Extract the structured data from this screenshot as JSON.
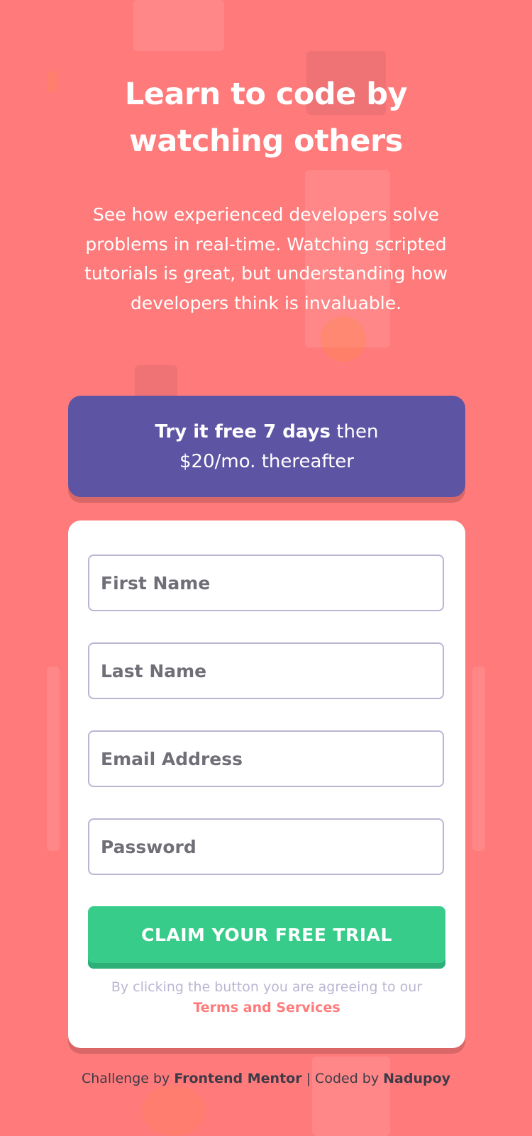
{
  "hero": {
    "title": "Learn to code by watching others",
    "description": "See how experienced developers solve problems in real-time. Watching scripted tutorials is great, but understanding how developers think is invaluable."
  },
  "promo": {
    "bold": "Try it free 7 days",
    "rest_1": " then",
    "rest_2": "$20/mo. thereafter"
  },
  "form": {
    "first_name_placeholder": "First Name",
    "last_name_placeholder": "Last Name",
    "email_placeholder": "Email Address",
    "password_placeholder": "Password",
    "submit_label": "CLAIM YOUR FREE TRIAL",
    "terms_prefix": "By clicking the button you are agreeing to our ",
    "terms_link": "Terms and Services"
  },
  "footer": {
    "challenge_prefix": "Challenge by ",
    "challenge_author": "Frontend Mentor",
    "separator": " | Coded by ",
    "coder": "Nadupoy"
  },
  "colors": {
    "background": "#ff7a7a",
    "promo": "#5e54a4",
    "cta": "#38cc8b",
    "link": "#ff7a7a"
  }
}
